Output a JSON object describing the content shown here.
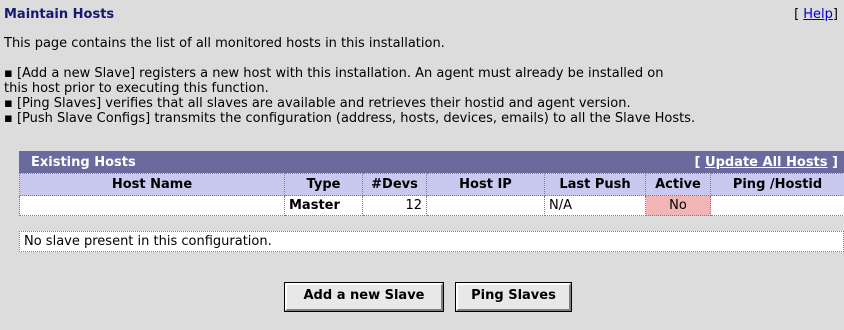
{
  "header": {
    "title": "Maintain Hosts",
    "help_prefix": "[",
    "help_label": "Help",
    "help_suffix": "]"
  },
  "intro": "This page contains the list of all monitored hosts in this installation.",
  "bullets": [
    "▪ [Add a new Slave] registers a new host with this installation. An agent must already be installed on",
    "this host prior to executing this function.",
    "▪ [Ping Slaves] verifies that all slaves are available and retrieves their hostid and agent version.",
    "▪ [Push Slave Configs] transmits the configuration (address, hosts, devices, emails) to all the Slave Hosts."
  ],
  "existing_hosts": {
    "title": "Existing Hosts",
    "update_prefix": "[",
    "update_label": "Update All Hosts",
    "update_suffix": "]",
    "columns": [
      "Host Name",
      "Type",
      "#Devs",
      "Host IP",
      "Last Push",
      "Active",
      "Ping /Hostid"
    ],
    "row": {
      "host_name": "",
      "type": "Master",
      "devs": "12",
      "host_ip": "",
      "last_push": "N/A",
      "active": "No",
      "ping": ""
    },
    "no_slave": "No slave present in this configuration."
  },
  "buttons": {
    "add_slave": "Add a new Slave",
    "ping_slaves": "Ping Slaves"
  },
  "colors": {
    "header_bar": "#6a6a9e",
    "col_header": "#c9c9f0",
    "inactive": "#f2b5b5",
    "title": "#18186e"
  }
}
